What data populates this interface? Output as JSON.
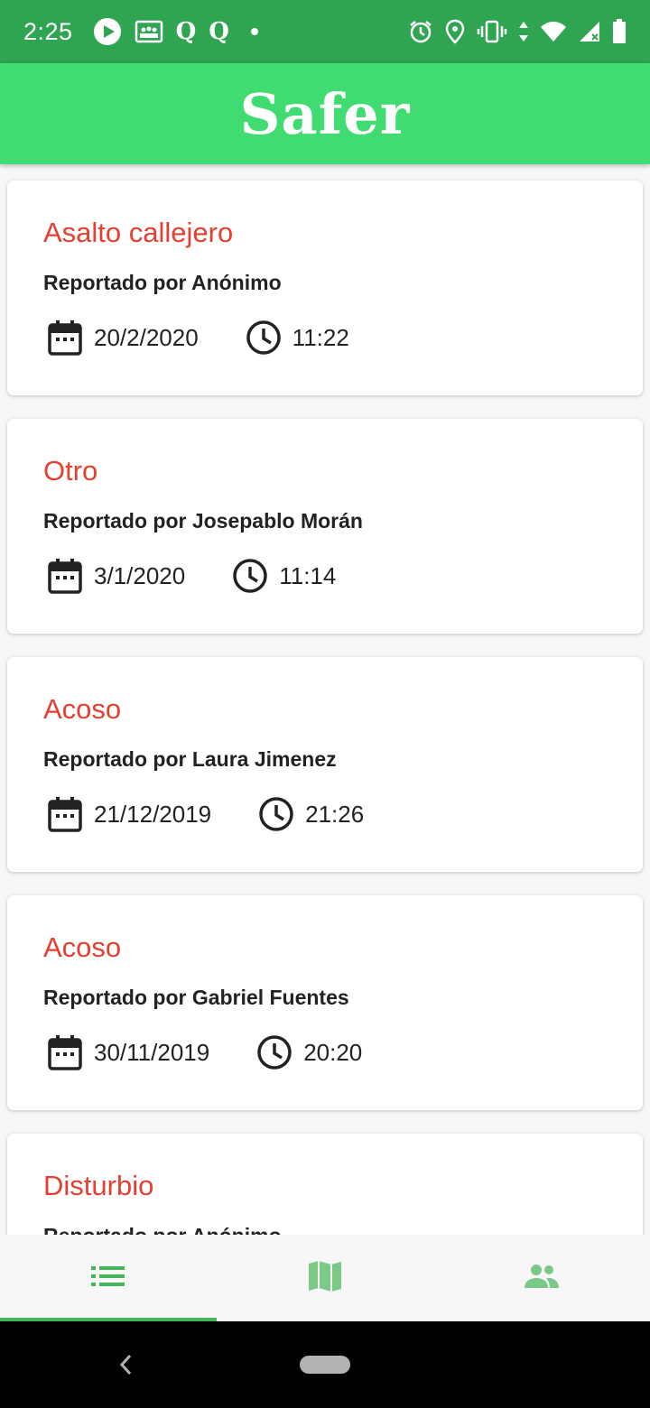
{
  "status_bar": {
    "time": "2:25",
    "left_icons": [
      "play-icon",
      "image-icon",
      "q-letter-icon",
      "q-letter-icon",
      "dot-icon"
    ],
    "right_icons": [
      "alarm-icon",
      "location-icon",
      "vibrate-icon",
      "data-arrows-icon",
      "wifi-icon",
      "cell-signal-icon",
      "battery-icon"
    ],
    "q_label": "Q"
  },
  "app_bar": {
    "title": "Safer",
    "color": "#40dc72"
  },
  "reports": [
    {
      "title": "Asalto callejero",
      "reporter": "Reportado por Anónimo",
      "date": "20/2/2020",
      "time": "11:22"
    },
    {
      "title": "Otro",
      "reporter": "Reportado por Josepablo Morán",
      "date": "3/1/2020",
      "time": "11:14"
    },
    {
      "title": "Acoso",
      "reporter": "Reportado por Laura Jimenez",
      "date": "21/12/2019",
      "time": "21:26"
    },
    {
      "title": "Acoso",
      "reporter": "Reportado por Gabriel Fuentes",
      "date": "30/11/2019",
      "time": "20:20"
    },
    {
      "title": "Disturbio",
      "reporter": "Reportado por Anónimo",
      "date": "",
      "time": ""
    }
  ],
  "bottom_nav": {
    "items": [
      {
        "icon": "list-icon",
        "active": true
      },
      {
        "icon": "map-icon",
        "active": false
      },
      {
        "icon": "people-icon",
        "active": false
      }
    ],
    "accent": "#43b55b"
  },
  "colors": {
    "status_bar": "#2fa552",
    "title_red": "#e53f32"
  }
}
